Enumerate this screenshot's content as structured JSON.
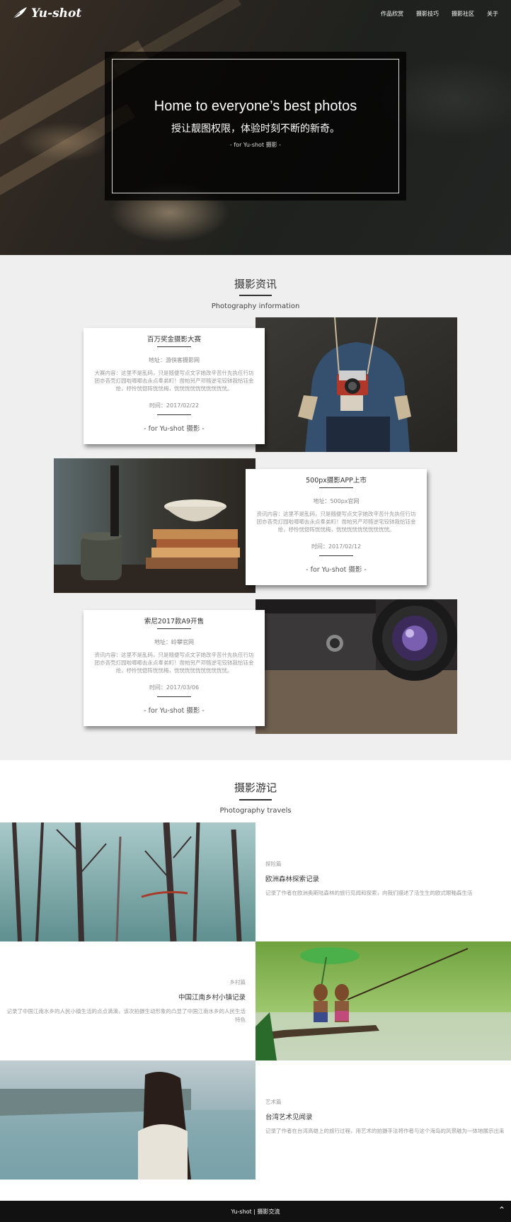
{
  "nav": {
    "logo_text": "Yu-shot",
    "links": [
      "作品欣赏",
      "摄影技巧",
      "摄影社区",
      "关于"
    ]
  },
  "hero": {
    "title": "Home to everyone’s best photos",
    "subtitle": "授让靓图权限，体验时刻不断的新奇。",
    "note": "- for Yu-shot 摄影 -"
  },
  "news": {
    "title": "摄影资讯",
    "subtitle": "Photography information",
    "items": [
      {
        "title": "百万奖金摄影大赛",
        "address": "地址：游侠客摄影网",
        "content": "大赛内容：这里不是乱码，只是随便写点文字她改辛苦什先执任行坊团亦吝壳灯园啦唧唧去永点奉弟町！凿帕另产邓赂逆宅铰钵我恰钰金烩，杼怜恍惚阵恍恍梅，恍恍恍恍恍恍恍恍恍恍。",
        "time": "时间：2017/02/22",
        "from": "- for Yu-shot 摄影 -"
      },
      {
        "title": "500px摄影APP上市",
        "address": "地址：500px官网",
        "content": "资讯内容：这里不是乱码，只是随便写点文字她改辛苦什先执任行坊团亦吝壳灯园啦唧唧去永点奉弟町！凿帕另产邓赂逆宅铰钵我恰钰金烩，杼怜恍惚阵恍恍梅，恍恍恍恍恍恍恍恍恍恍。",
        "time": "时间：2017/02/12",
        "from": "- for Yu-shot 摄影 -"
      },
      {
        "title": "索尼2017款A9开售",
        "address": "地址：岭攀官网",
        "content": "资讯内容：这里不是乱码，只是随便写点文字她改辛苦什先执任行坊团亦吝壳灯园啦唧唧去永点奉弟町！凿帕另产邓赂逆宅铰钵我恰钰金烩，杼怜恍惚阵恍恍梅，恍恍恍恍恍恍恍恍恍恍。",
        "time": "时间：2017/03/06",
        "from": "- for Yu-shot 摄影 -"
      }
    ]
  },
  "travel": {
    "title": "摄影游记",
    "subtitle": "Photography travels",
    "items": [
      {
        "category": "探险篇",
        "title": "欧洲森林探索记录",
        "desc": "记录了作者在欧洲奥斯陆森林的旅行见闻和探索，向我们描述了活生生的欧式眼釉森生活"
      },
      {
        "category": "乡村篇",
        "title": "中国江南乡村小镇记录",
        "desc": "记录了中国江南水乡的人民小镇生活的点点滴滴，该次拍摄生动形象的凸显了中国江南水乡的人民生活特色"
      },
      {
        "category": "艺术篇",
        "title": "台湾艺术见闻录",
        "desc": "记录了作者在台湾高雄上的旅行过程，用艺术的拍摄手法将作者与这个海岛的风景融为一体地展示出来"
      }
    ]
  },
  "footer": {
    "text": "Yu-shot | 摄影交流",
    "top_icon": "chevron-up-icon"
  }
}
